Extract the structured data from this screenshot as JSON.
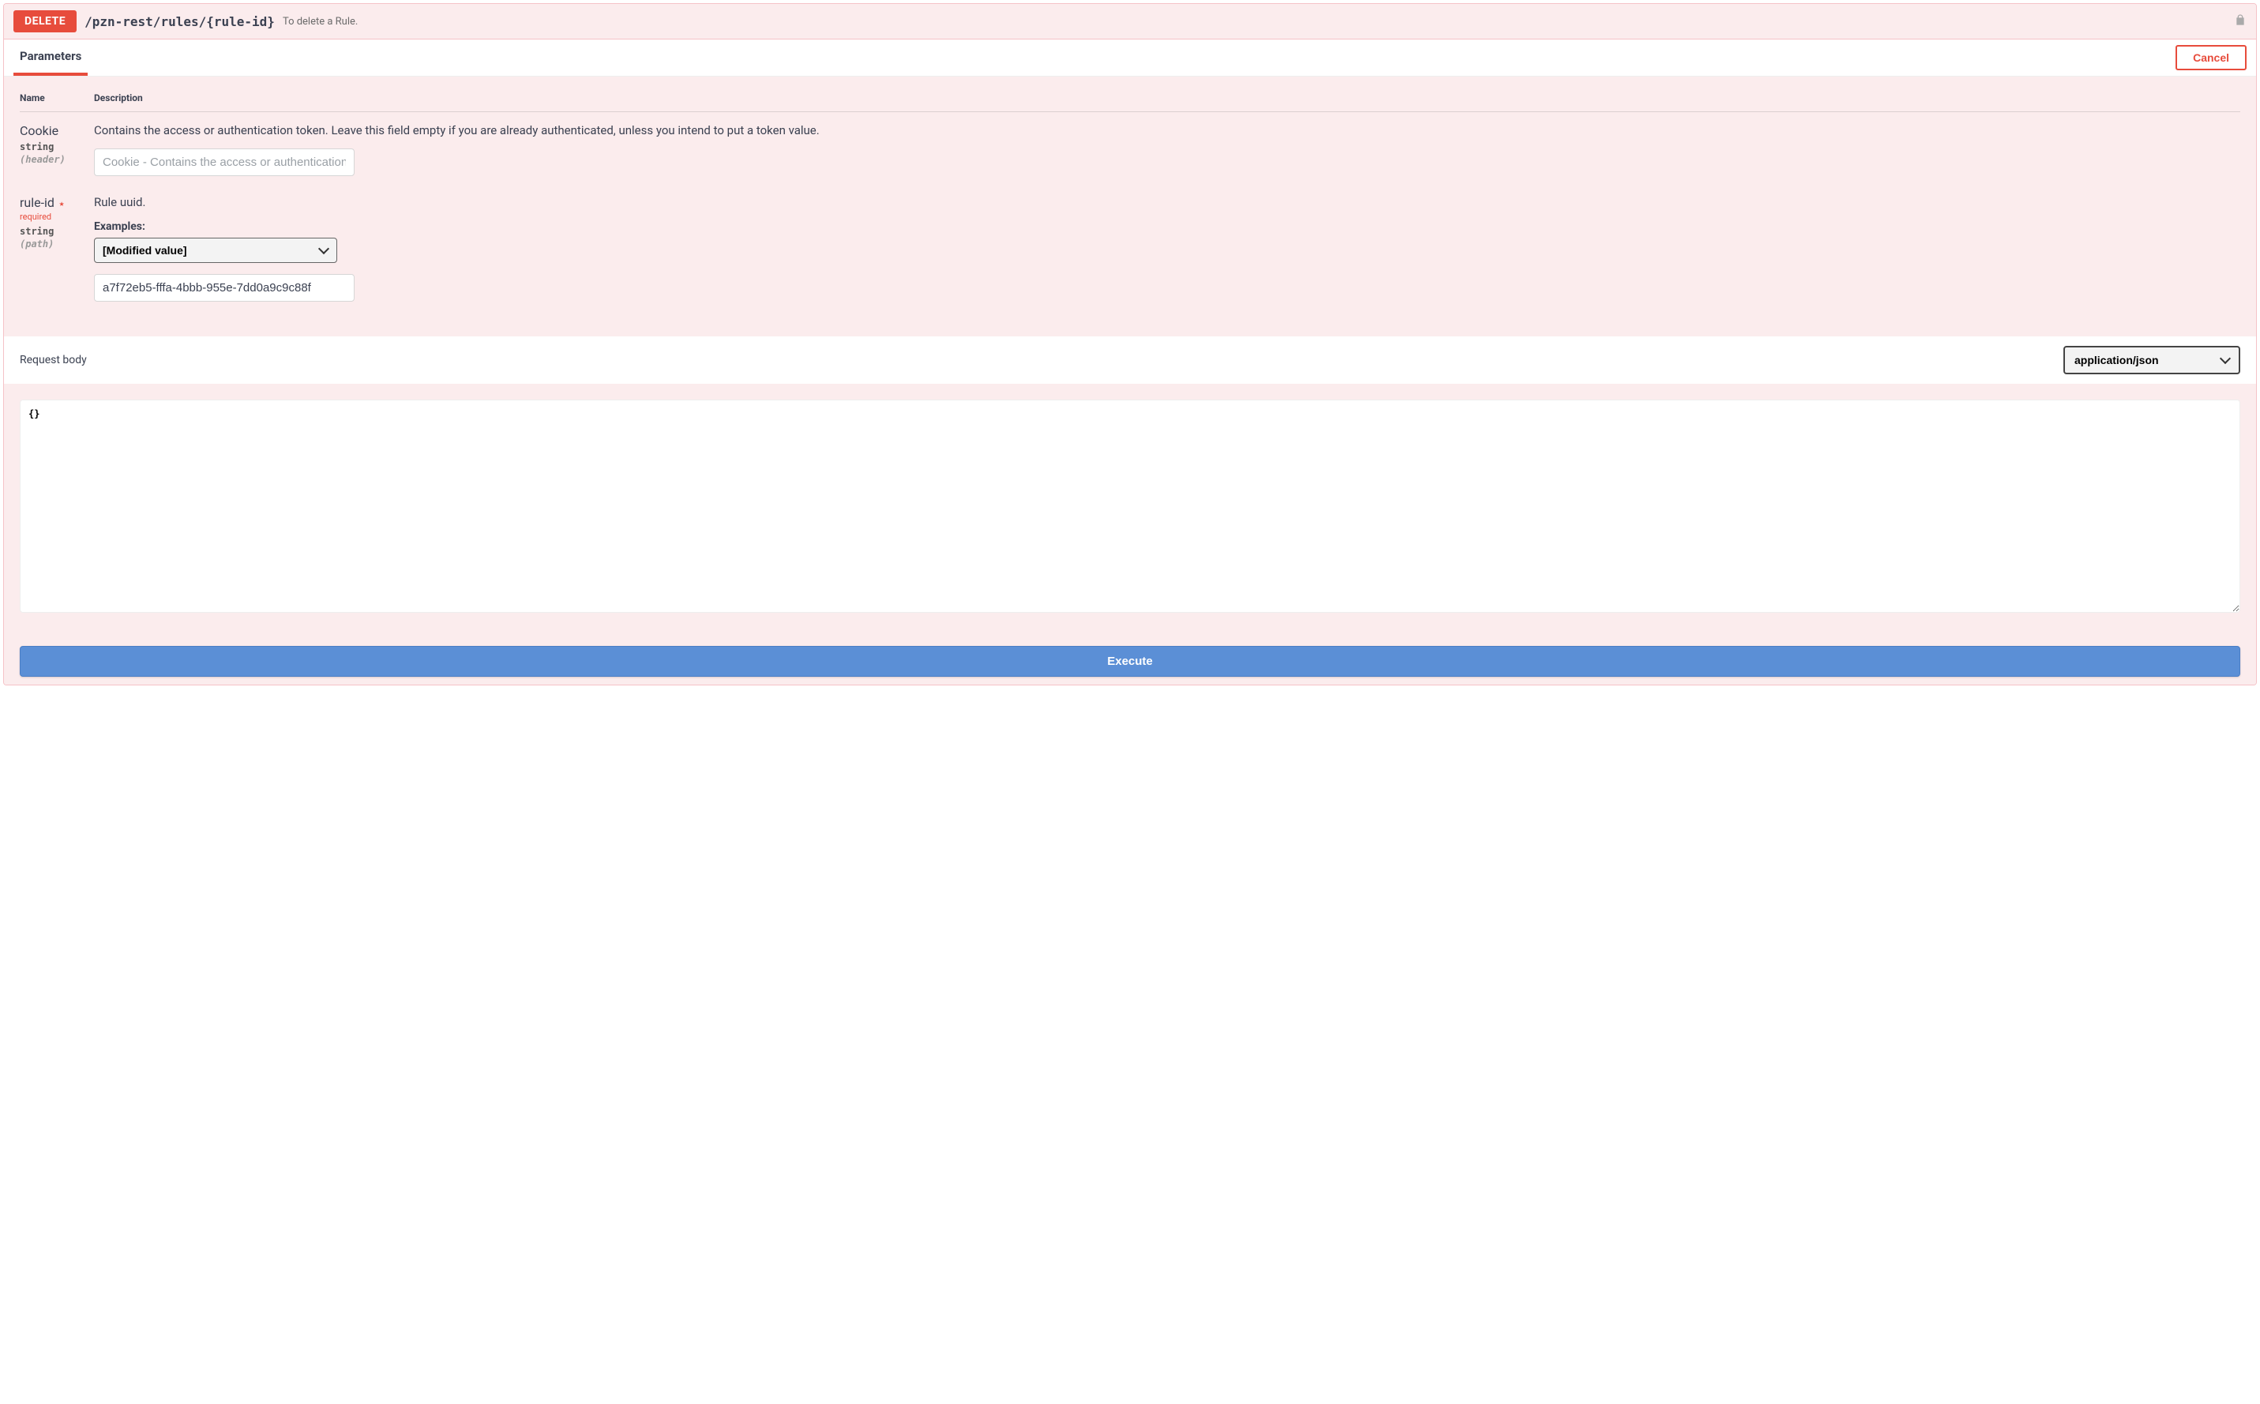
{
  "operation": {
    "method": "DELETE",
    "path": "/pzn-rest/rules/{rule-id}",
    "summary": "To delete a Rule."
  },
  "tabs": {
    "parameters": "Parameters",
    "cancel": "Cancel"
  },
  "table_headers": {
    "name": "Name",
    "description": "Description"
  },
  "params": {
    "cookie": {
      "name": "Cookie",
      "type": "string",
      "location": "(header)",
      "description": "Contains the access or authentication token. Leave this field empty if you are already authenticated, unless you intend to put a token value.",
      "placeholder": "Cookie - Contains the access or authentication token. Leave this field empty if you are already authenticated, unless you intend to put a token value."
    },
    "rule_id": {
      "name": "rule-id",
      "required_label": "required",
      "type": "string",
      "location": "(path)",
      "description": "Rule uuid.",
      "examples_label": "Examples:",
      "examples_selected": "[Modified value]",
      "value": "a7f72eb5-fffa-4bbb-955e-7dd0a9c9c88f"
    }
  },
  "request_body": {
    "label": "Request body",
    "content_type": "application/json",
    "value": "{}"
  },
  "buttons": {
    "execute": "Execute"
  }
}
